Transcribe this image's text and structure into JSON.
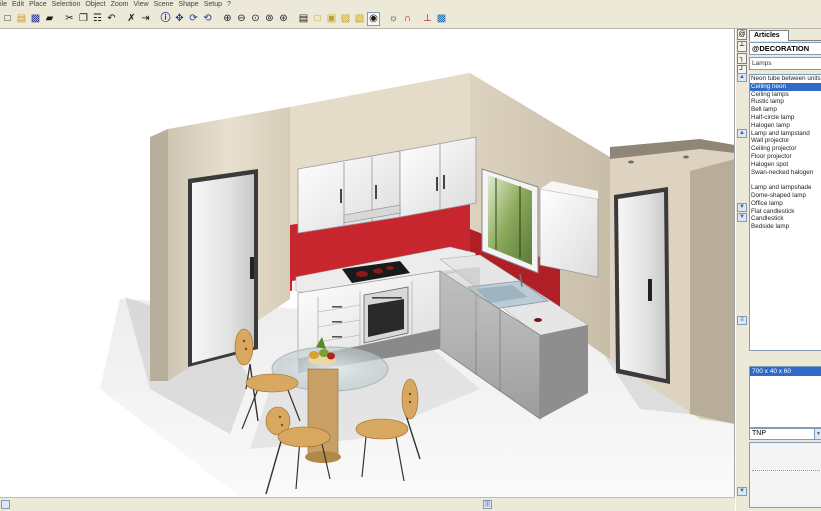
{
  "menu": [
    "ile",
    "Edit",
    "Place",
    "Selection",
    "Object",
    "Zoom",
    "View",
    "Scene",
    "Shape",
    "Setup",
    "?"
  ],
  "toolbar": {
    "icons": [
      "new-file-icon",
      "open-folder-icon",
      "save-icon",
      "print-icon",
      "cut-icon",
      "copy-icon",
      "paste-icon",
      "undo-icon",
      "delete-icon",
      "insert-icon",
      "info-icon",
      "move-icon",
      "rotate-icon",
      "rotate-3d-icon",
      "zoom-in-icon",
      "zoom-out-icon",
      "zoom-window-icon",
      "zoom-all-icon",
      "zoom-fit-icon",
      "display-icon",
      "view-top-icon",
      "view-front-icon",
      "view-side-icon",
      "view-3d-icon",
      "photo-icon",
      "light-icon",
      "magnet-icon",
      "axis-icon",
      "measure-icon"
    ]
  },
  "side_tabs": [
    "@",
    "┴",
    "┐",
    "┘"
  ],
  "panel": {
    "tab_label": "Articles",
    "category": "@DECORATION",
    "subcategory": "Lamps",
    "items": [
      "Neon tube between units",
      "Ceiling neon",
      "Ceiling lamps",
      "Rustic lamp",
      "Bell lamp",
      "Half-circle lamp",
      "Halogen lamp",
      "Lamp and lampstand",
      "Wall projector",
      "Ceiling projector",
      "Floor projector",
      "Halogen spot",
      "Swan-necked halogen",
      "",
      "Lamp and lampshade",
      "Dome-shaped lamp",
      "Office lamp",
      "Flat candlestick",
      "Candlestick",
      "Bedside lamp"
    ],
    "selected_index": 1,
    "dimensions": "700 x 40 x 60",
    "finish": "TNP"
  },
  "colors": {
    "accent_selection": "#316ac5",
    "wall_red": "#c8262e",
    "wall_beige": "#e6ddcb",
    "cabinet_white": "#f2f2f2",
    "chair_wood": "#d8a860"
  }
}
